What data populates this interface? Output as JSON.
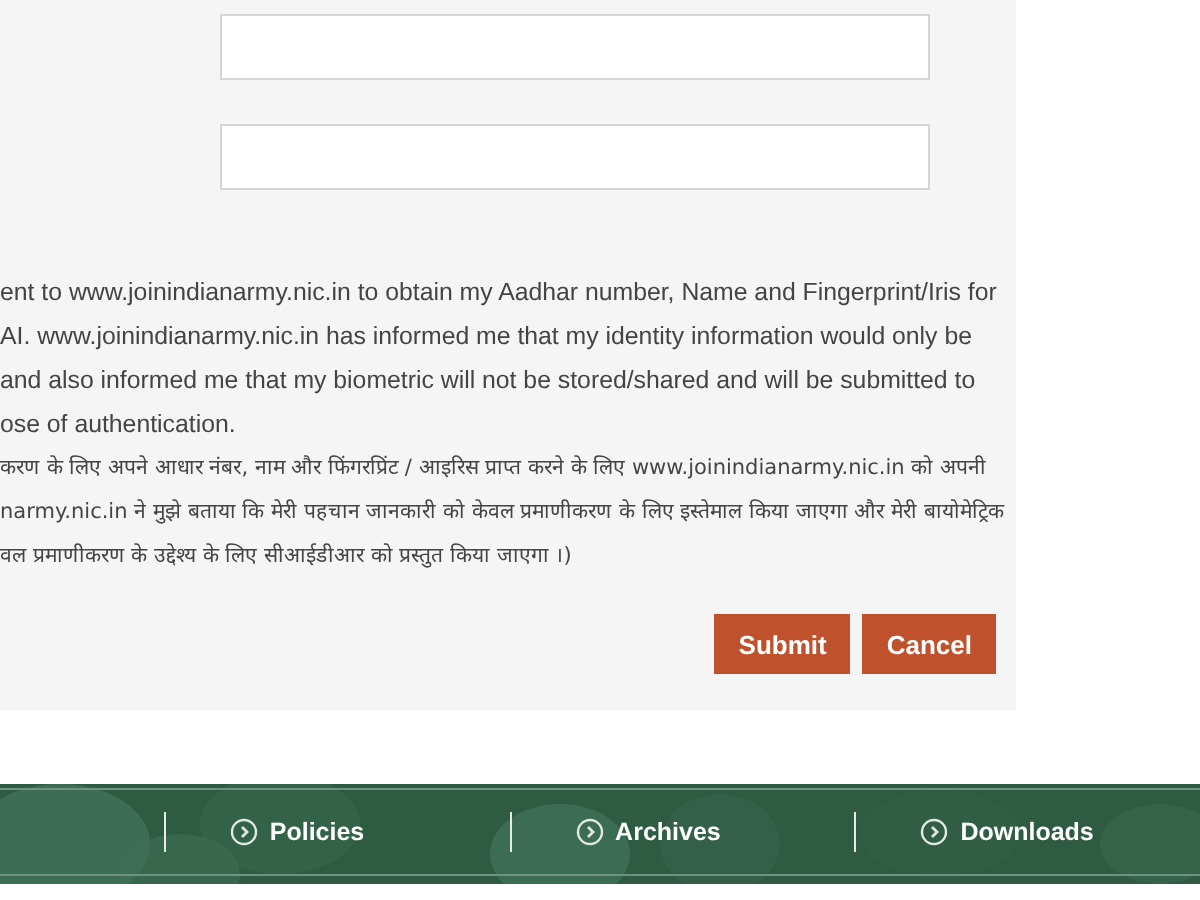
{
  "form": {
    "fields": [
      {
        "kind": "text"
      },
      {
        "kind": "text"
      }
    ],
    "consent_english": [
      "ent to www.joinindianarmy.nic.in to obtain my Aadhar number, Name and Fingerprint/Iris for",
      "AI. www.joinindianarmy.nic.in has informed me that my identity information would only be",
      "and also informed me that my biometric will not be stored/shared and will be submitted to",
      "ose of authentication."
    ],
    "consent_hindi": [
      "करण के लिए अपने आधार नंबर, नाम और फिंगरप्रिंट / आइरिस प्राप्त करने के लिए www.joinindianarmy.nic.in को अपनी",
      "narmy.nic.in ने मुझे बताया कि मेरी पहचान जानकारी को केवल प्रमाणीकरण के लिए इस्तेमाल किया जाएगा और मेरी बायोमेट्रिक",
      "वल प्रमाणीकरण के उद्देश्य के लिए सीआईडीआर को प्रस्तुत किया जाएगा ।)"
    ],
    "buttons": [
      "Submit",
      "Cancel"
    ]
  },
  "footer": {
    "links": [
      "Policies",
      "Archives",
      "Downloads"
    ]
  }
}
